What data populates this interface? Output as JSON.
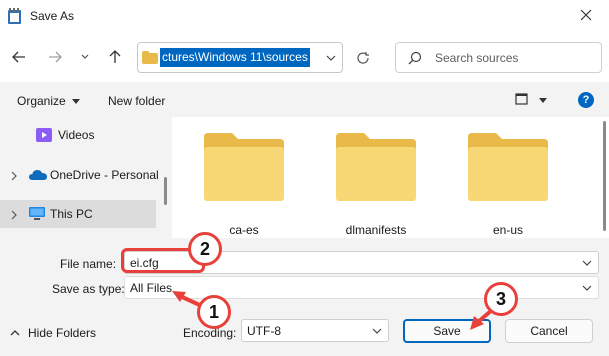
{
  "window": {
    "title": "Save As"
  },
  "address": {
    "path": "ctures\\Windows 11\\sources"
  },
  "search": {
    "placeholder": "Search sources"
  },
  "commands": {
    "organize": "Organize",
    "new_folder": "New folder"
  },
  "nav_pane": {
    "items": [
      {
        "label": "Videos",
        "icon": "videos-icon"
      },
      {
        "label": "OneDrive - Personal",
        "icon": "onedrive-icon"
      },
      {
        "label": "This PC",
        "icon": "this-pc-icon"
      }
    ]
  },
  "folders": [
    {
      "name": "ca-es"
    },
    {
      "name": "dlmanifests"
    },
    {
      "name": "en-us"
    }
  ],
  "form": {
    "file_name_label": "File name:",
    "file_name_value": "ei.cfg",
    "save_type_label": "Save as type:",
    "save_type_value": "All Files",
    "encoding_label": "Encoding:",
    "encoding_value": "UTF-8",
    "hide_folders": "Hide Folders",
    "save_button": "Save",
    "cancel_button": "Cancel"
  },
  "annotations": {
    "badge_1": "1",
    "badge_2": "2",
    "badge_3": "3"
  },
  "colors": {
    "accent": "#0067c0",
    "annotation": "#e8403a",
    "folder": "#f8d775"
  }
}
